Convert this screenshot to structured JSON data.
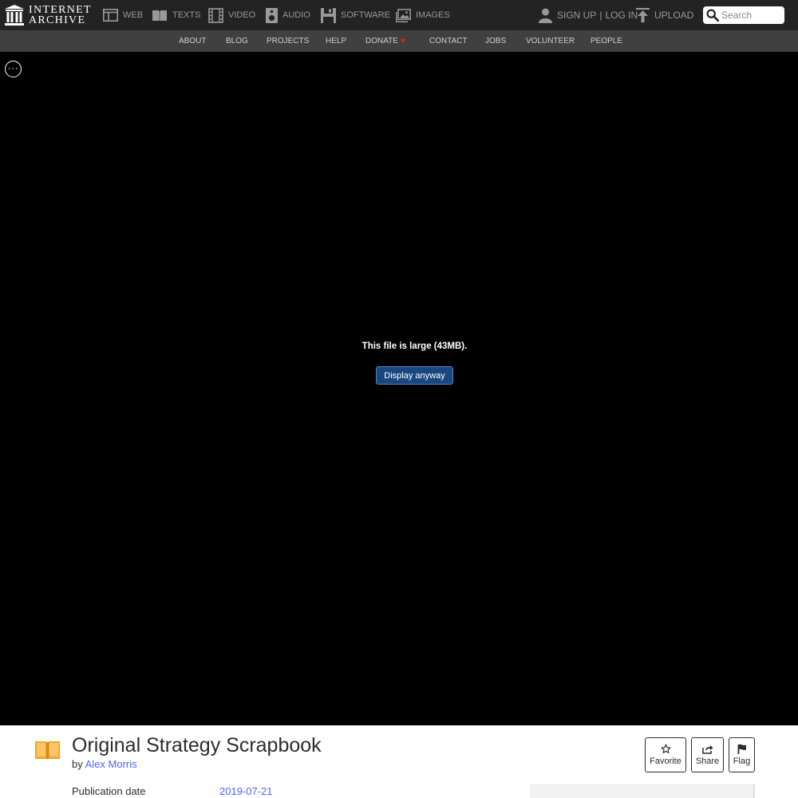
{
  "header": {
    "logo_line1": "INTERNET",
    "logo_line2": "ARCHIVE",
    "media": [
      {
        "label": "WEB",
        "icon": "web-icon"
      },
      {
        "label": "TEXTS",
        "icon": "texts-icon"
      },
      {
        "label": "VIDEO",
        "icon": "video-icon"
      },
      {
        "label": "AUDIO",
        "icon": "audio-icon"
      },
      {
        "label": "SOFTWARE",
        "icon": "software-icon"
      },
      {
        "label": "IMAGES",
        "icon": "images-icon"
      }
    ],
    "sign_up": "SIGN UP",
    "separator": "|",
    "log_in": "LOG IN",
    "upload": "UPLOAD",
    "search_placeholder": "Search"
  },
  "subnav": {
    "items": [
      "ABOUT",
      "BLOG",
      "PROJECTS",
      "HELP",
      "DONATE",
      "CONTACT",
      "JOBS",
      "VOLUNTEER",
      "PEOPLE"
    ],
    "donate_heart": "♥"
  },
  "viewer": {
    "more_glyph": "···",
    "message": "This file is large (43MB).",
    "display_button": "Display anyway"
  },
  "item": {
    "title": "Original Strategy Scrapbook",
    "by_prefix": "by",
    "author": "Alex Morris",
    "actions": [
      {
        "label": "Favorite",
        "icon": "star-icon"
      },
      {
        "label": "Share",
        "icon": "share-icon"
      },
      {
        "label": "Flag",
        "icon": "flag-icon"
      }
    ],
    "metadata": [
      {
        "key": "Publication date",
        "value": "2019-07-21"
      }
    ]
  },
  "colors": {
    "nav_bg": "#232323",
    "subnav_bg": "#404040",
    "link": "#4b64ff",
    "button_blue": "#194880",
    "texts_icon": "#f5a623",
    "heart": "#e2231a"
  }
}
